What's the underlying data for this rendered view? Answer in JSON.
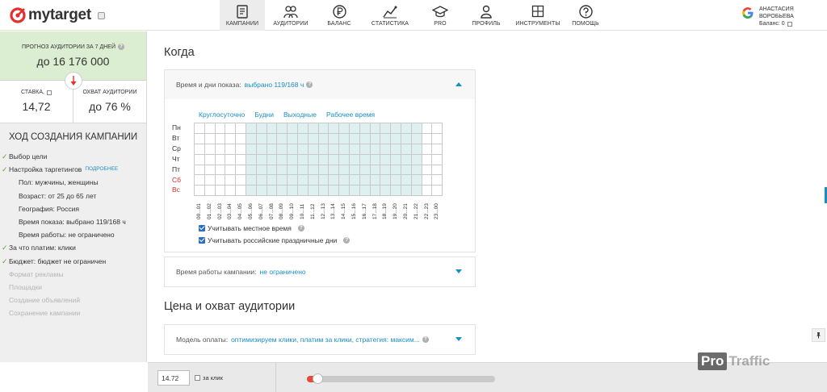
{
  "brand": {
    "name": "mytarget",
    "color": "#e62e2e"
  },
  "nav": [
    {
      "label": "Кампании",
      "icon": "campaign-doc-icon",
      "active": true
    },
    {
      "label": "Аудитории",
      "icon": "audience-users-icon",
      "active": false
    },
    {
      "label": "Баланс",
      "icon": "ruble-icon",
      "active": false
    },
    {
      "label": "Статистика",
      "icon": "stats-chart-icon",
      "active": false
    },
    {
      "label": "PRO",
      "icon": "graduation-cap-icon",
      "active": false
    },
    {
      "label": "Профиль",
      "icon": "profile-icon",
      "active": false
    },
    {
      "label": "Инструменты",
      "icon": "tools-icon",
      "active": false
    },
    {
      "label": "Помощь",
      "icon": "help-icon",
      "active": false
    }
  ],
  "user": {
    "name": "АНАСТАСИЯ ВОРОБЬЕВА",
    "balance": "Баланс: 0"
  },
  "forecast": {
    "label": "ПРОГНОЗ АУДИТОРИИ ЗА 7 ДНЕЙ",
    "value": "до 16 176 000"
  },
  "metrics": {
    "bid": {
      "label": "СТАВКА,",
      "value": "14,72"
    },
    "reach": {
      "label": "ОХВАТ АУДИТОРИИ",
      "value": "до 76 %"
    }
  },
  "steps": {
    "title": "ХОД СОЗДАНИЯ КАМПАНИИ",
    "more_label": "ПОДРОБНЕЕ",
    "items": [
      {
        "text": "Выбор цели",
        "kind": "done"
      },
      {
        "text": "Настройка таргетингов",
        "kind": "done",
        "more": true
      },
      {
        "text": "Пол: мужчины, женщины",
        "kind": "sub"
      },
      {
        "text": "Возраст: от 25 до 65 лет",
        "kind": "sub"
      },
      {
        "text": "География: Россия",
        "kind": "sub"
      },
      {
        "text": "Время показа: выбрано 119/168 ч",
        "kind": "sub"
      },
      {
        "text": "Время работы: не ограничено",
        "kind": "sub"
      },
      {
        "text": "За что платим: клики",
        "kind": "done"
      },
      {
        "text": "Бюджет: бюджет не ограничен",
        "kind": "done"
      },
      {
        "text": "Формат рекламы",
        "kind": "disabled"
      },
      {
        "text": "Площадки",
        "kind": "disabled"
      },
      {
        "text": "Создание объявлений",
        "kind": "disabled"
      },
      {
        "text": "Сохранение кампании",
        "kind": "disabled"
      }
    ]
  },
  "when": {
    "title": "Когда",
    "schedule_label": "Время и дни показа:",
    "schedule_value": "выбрано 119/168 ч",
    "presets": [
      "Круглосуточно",
      "Будни",
      "Выходные",
      "Рабочее время"
    ],
    "days": [
      "Пн",
      "Вт",
      "Ср",
      "Чт",
      "Пт",
      "Сб",
      "Вс"
    ],
    "weekend_days": [
      5,
      6
    ],
    "hours": [
      "00...01",
      "01...02",
      "02...03",
      "03...04",
      "04...05",
      "05...06",
      "06...07",
      "07...08",
      "08...09",
      "09...10",
      "10...11",
      "11...12",
      "12...13",
      "13...14",
      "14...15",
      "15...16",
      "16...17",
      "17...18",
      "18...19",
      "19...20",
      "20...21",
      "21...22",
      "22...23",
      "23...00"
    ],
    "selected_hours_from": 5,
    "selected_hours_to": 21,
    "local_time_label": "Учитывать местное время",
    "holidays_label": "Учитывать российские праздничные дни",
    "runtime_label": "Время работы кампании:",
    "runtime_value": "не ограничено"
  },
  "price": {
    "title": "Цена и охват аудитории",
    "model_label": "Модель оплаты:",
    "model_value": "оптимизируем клики, платим за клики, стратегия: максим..."
  },
  "bottom": {
    "bid_value": "14.72",
    "per_click_label": "за клик",
    "slider_fraction": 0.04
  },
  "watermark": {
    "part1": "Pro",
    "part2": "Traffic"
  },
  "colors": {
    "accent": "#1a8ec4",
    "forecast_bg": "#dbeed1",
    "check": "#5aa544",
    "weekend": "#d0312d",
    "selected_cell": "#dff0f0"
  }
}
